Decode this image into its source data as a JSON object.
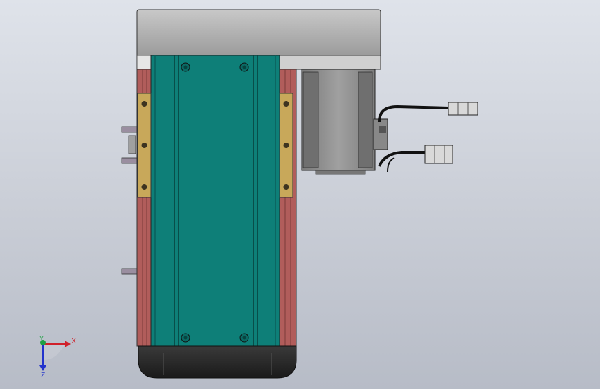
{
  "viewport": {
    "background_top": "#dfe3ea",
    "background_bottom": "#b7bcc7"
  },
  "model": {
    "colors": {
      "top_block": "#a6a6a6",
      "teal_body": "#0e7f78",
      "teal_dark": "#0a5f5a",
      "side_rail": "#b15d5b",
      "bracket": "#c8a85a",
      "motor": "#8f8f8f",
      "motor_dark": "#6f6f6f",
      "bottom_cap": "#2a2a2a",
      "cable": "#111111",
      "connector": "#d9d9d9"
    }
  },
  "triad": {
    "x_label": "X",
    "y_label": "Y",
    "z_label": "Z",
    "x_color": "#d0202a",
    "y_color": "#1fa043",
    "z_color": "#2233cc"
  }
}
